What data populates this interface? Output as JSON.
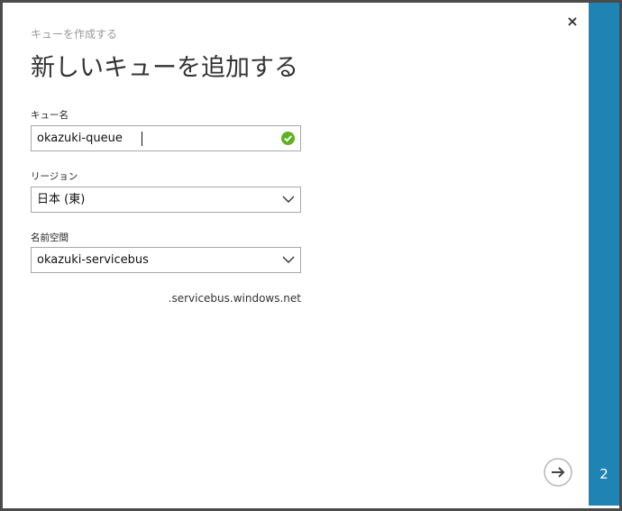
{
  "dialog": {
    "subtitle": "キューを作成する",
    "title": "新しいキューを追加する",
    "close_label": "×"
  },
  "form": {
    "queue_name": {
      "label": "キュー名",
      "value": "okazuki-queue",
      "valid": true
    },
    "region": {
      "label": "リージョン",
      "selected": "日本 (東)"
    },
    "namespace": {
      "label": "名前空間",
      "selected": "okazuki-servicebus"
    },
    "domain_suffix": ".servicebus.windows.net"
  },
  "wizard": {
    "step_number": "2",
    "next_icon": "arrow-right-circle-icon"
  },
  "colors": {
    "accent": "#1f83b4",
    "valid_green": "#5cb21f",
    "frame": "#4b4b4b"
  }
}
